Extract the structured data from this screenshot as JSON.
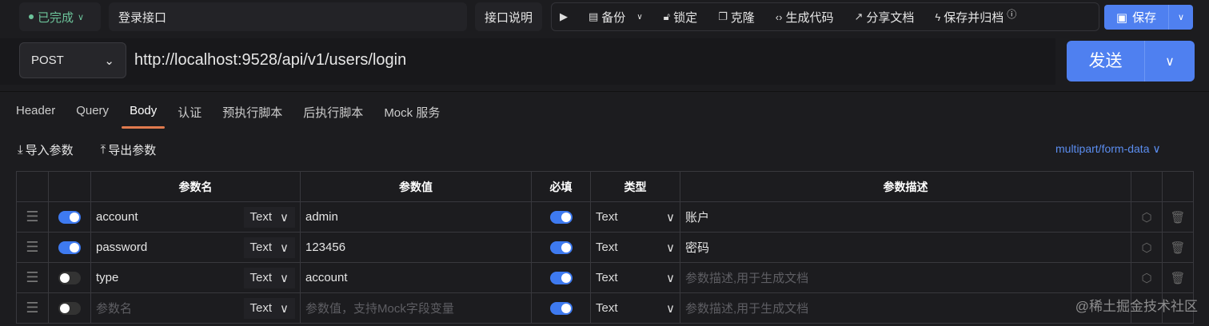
{
  "header": {
    "status": "已完成",
    "title": "登录接口",
    "doc_button": "接口说明",
    "toolbar": [
      {
        "icon": "play-icon",
        "label": ""
      },
      {
        "icon": "backup-icon",
        "label": "备份"
      },
      {
        "icon": "lock-icon",
        "label": "锁定"
      },
      {
        "icon": "clone-icon",
        "label": "克隆"
      },
      {
        "icon": "code-icon",
        "label": "生成代码"
      },
      {
        "icon": "share-icon",
        "label": "分享文档"
      },
      {
        "icon": "archive-icon",
        "label": "保存并归档"
      }
    ],
    "save": "保存"
  },
  "request": {
    "method": "POST",
    "url": "http://localhost:9528/api/v1/users/login",
    "send": "发送"
  },
  "tabs": [
    "Header",
    "Query",
    "Body",
    "认证",
    "预执行脚本",
    "后执行脚本",
    "Mock 服务"
  ],
  "active_tab": "Body",
  "actions": {
    "import": "导入参数",
    "export": "导出参数",
    "content_type": "multipart/form-data"
  },
  "table": {
    "headers": {
      "name": "参数名",
      "value": "参数值",
      "required": "必填",
      "type": "类型",
      "desc": "参数描述"
    },
    "rows": [
      {
        "enabled": true,
        "name": "account",
        "name_type": "Text",
        "value": "admin",
        "required": true,
        "type": "Text",
        "desc": "账户"
      },
      {
        "enabled": true,
        "name": "password",
        "name_type": "Text",
        "value": "123456",
        "required": true,
        "type": "Text",
        "desc": "密码"
      },
      {
        "enabled": false,
        "name": "type",
        "name_type": "Text",
        "value": "account",
        "required": true,
        "type": "Text",
        "desc": "参数描述,用于生成文档"
      },
      {
        "enabled": false,
        "name": "参数名",
        "name_type": "Text",
        "value": "参数值，支持Mock字段变量",
        "required": true,
        "type": "Text",
        "desc": "参数描述,用于生成文档"
      }
    ]
  },
  "watermark": "@稀土掘金技术社区",
  "colors": {
    "accent": "#4f80f0",
    "status": "#6cc39a",
    "tab_underline": "#e07a4e"
  }
}
